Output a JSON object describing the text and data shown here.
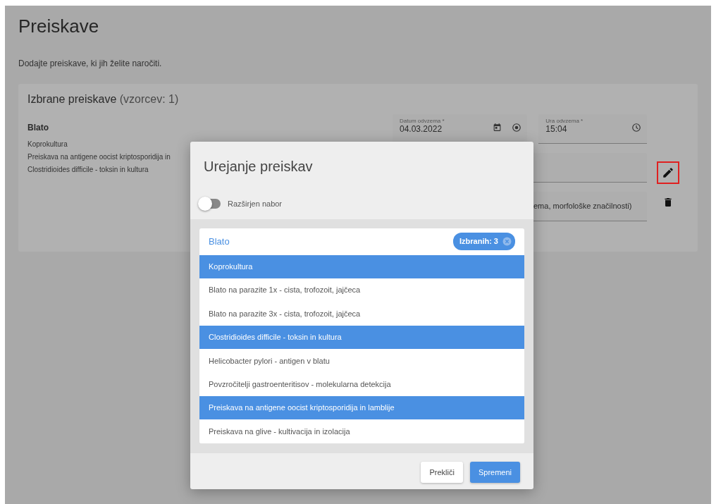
{
  "page": {
    "title": "Preiskave",
    "subtitle": "Dodajte preiskave, ki jih želite naročiti."
  },
  "selected_card": {
    "title": "Izbrane preiskave",
    "count": "(vzorcev: 1)",
    "sample": "Blato",
    "tests": [
      "Koprokultura",
      "Preiskava na antigene oocist kriptosporidija in",
      "Clostridioides difficile - toksin in kultura"
    ],
    "fields": [
      {
        "kind": "date",
        "label": "Datum odvzema *",
        "value": "04.03.2022"
      },
      {
        "kind": "time",
        "label": "Ura odvzema *",
        "value": "15:04"
      },
      {
        "kind": "blank"
      },
      {
        "kind": "text",
        "value": "ema, morfološke značilnosti)"
      }
    ],
    "actions": [
      {
        "kind": "edit",
        "highlighted": true
      },
      {
        "kind": "delete",
        "highlighted": false
      }
    ]
  },
  "modal": {
    "title": "Urejanje preiskav",
    "toggle": {
      "label": "Razširjen nabor",
      "on": false
    },
    "group": {
      "name": "Blato",
      "badge": "Izbranih: 3"
    },
    "items": [
      {
        "label": "Koprokultura",
        "selected": true
      },
      {
        "label": "Blato na parazite 1x - cista, trofozoit, jajčeca",
        "selected": false
      },
      {
        "label": "Blato na parazite 3x - cista, trofozoit, jajčeca",
        "selected": false
      },
      {
        "label": "Clostridioides difficile - toksin in kultura",
        "selected": true
      },
      {
        "label": "Helicobacter pylori - antigen v blatu",
        "selected": false
      },
      {
        "label": "Povzročitelji gastroenteritisov - molekularna detekcija",
        "selected": false
      },
      {
        "label": "Preiskava na antigene oocist kriptosporidija in lamblije",
        "selected": true
      },
      {
        "label": "Preiskava na glive - kultivacija in izolacija",
        "selected": false
      }
    ],
    "buttons": [
      {
        "label": "Prekliči",
        "kind": "secondary"
      },
      {
        "label": "Spremeni",
        "kind": "primary"
      }
    ]
  }
}
